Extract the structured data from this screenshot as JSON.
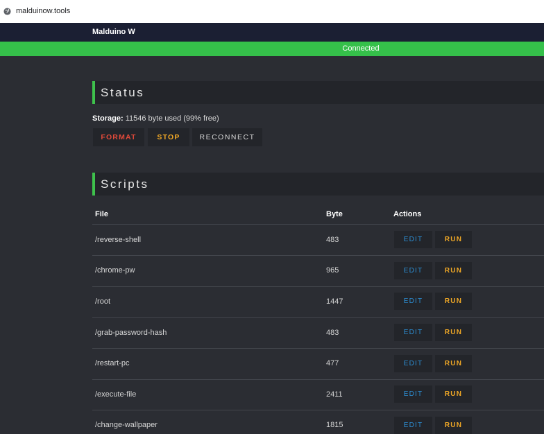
{
  "browser": {
    "url": "malduinow.tools"
  },
  "header": {
    "brand": "Malduino W"
  },
  "connection": {
    "status": "Connected",
    "color": "#35c04a"
  },
  "status_section": {
    "title": "Status",
    "storage_label": "Storage:",
    "storage_value": "11546 byte used (99% free)",
    "buttons": {
      "format": "FORMAT",
      "stop": "STOP",
      "reconnect": "RECONNECT"
    }
  },
  "scripts_section": {
    "title": "Scripts",
    "columns": {
      "file": "File",
      "byte": "Byte",
      "actions": "Actions"
    },
    "rows": [
      {
        "file": "/reverse-shell",
        "byte": "483",
        "edit": "EDIT",
        "run": "RUN"
      },
      {
        "file": "/chrome-pw",
        "byte": "965",
        "edit": "EDIT",
        "run": "RUN"
      },
      {
        "file": "/root",
        "byte": "1447",
        "edit": "EDIT",
        "run": "RUN"
      },
      {
        "file": "/grab-password-hash",
        "byte": "483",
        "edit": "EDIT",
        "run": "RUN"
      },
      {
        "file": "/restart-pc",
        "byte": "477",
        "edit": "EDIT",
        "run": "RUN"
      },
      {
        "file": "/execute-file",
        "byte": "2411",
        "edit": "EDIT",
        "run": "RUN"
      },
      {
        "file": "/change-wallpaper",
        "byte": "1815",
        "edit": "EDIT",
        "run": "RUN"
      }
    ]
  },
  "colors": {
    "accent": "#3ec14c",
    "danger": "#e24a3a",
    "warning": "#f0a826",
    "info": "#2d8fd5"
  }
}
